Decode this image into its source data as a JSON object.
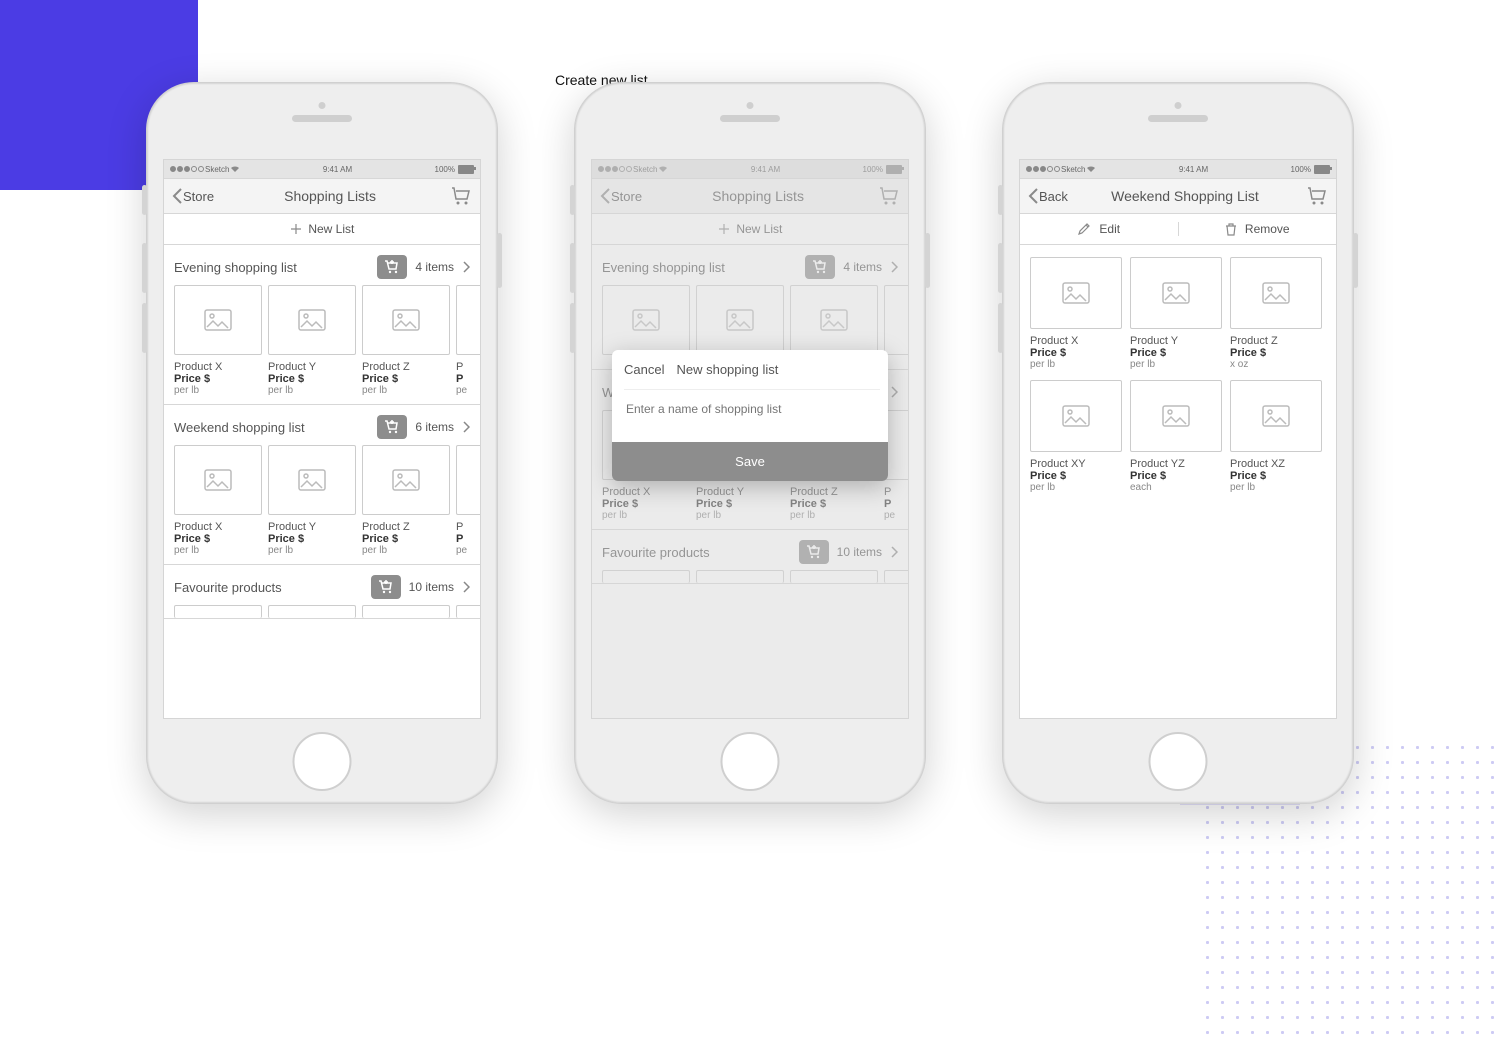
{
  "clip_label": "Create new list",
  "statusbar": {
    "carrier": "Sketch",
    "time": "9:41 AM",
    "battery": "100%"
  },
  "actionbar": {
    "new_list": "New List"
  },
  "screen1": {
    "back": "Store",
    "title": "Shopping Lists",
    "sections": [
      {
        "title": "Evening shopping list",
        "count": "4 items",
        "products": [
          {
            "name": "Product X",
            "price": "Price $",
            "unit": "per lb"
          },
          {
            "name": "Product Y",
            "price": "Price $",
            "unit": "per lb"
          },
          {
            "name": "Product Z",
            "price": "Price $",
            "unit": "per lb"
          },
          {
            "name": "P",
            "price": "P",
            "unit": "pe"
          }
        ]
      },
      {
        "title": "Weekend shopping list",
        "count": "6 items",
        "products": [
          {
            "name": "Product X",
            "price": "Price $",
            "unit": "per lb"
          },
          {
            "name": "Product Y",
            "price": "Price $",
            "unit": "per lb"
          },
          {
            "name": "Product Z",
            "price": "Price $",
            "unit": "per lb"
          },
          {
            "name": "P",
            "price": "P",
            "unit": "pe"
          }
        ]
      },
      {
        "title": "Favourite products",
        "count": "10 items",
        "products": []
      }
    ]
  },
  "screen2": {
    "back": "Store",
    "title": "Shopping Lists",
    "modal": {
      "cancel": "Cancel",
      "heading": "New shopping list",
      "placeholder": "Enter a name of shopping list",
      "save": "Save"
    },
    "sections": [
      {
        "title": "Evening shopping list",
        "count": "4 items",
        "products": [
          {
            "name": "",
            "price": "",
            "unit": ""
          },
          {
            "name": "",
            "price": "",
            "unit": ""
          },
          {
            "name": "",
            "price": "",
            "unit": ""
          },
          {
            "name": "",
            "price": "",
            "unit": ""
          }
        ]
      },
      {
        "title": "W",
        "count": "",
        "products": [
          {
            "name": "Product X",
            "price": "Price $",
            "unit": "per lb"
          },
          {
            "name": "Product Y",
            "price": "Price $",
            "unit": "per lb"
          },
          {
            "name": "Product Z",
            "price": "Price $",
            "unit": "per lb"
          },
          {
            "name": "P",
            "price": "P",
            "unit": "pe"
          }
        ]
      },
      {
        "title": "Favourite products",
        "count": "10 items",
        "products": []
      }
    ]
  },
  "screen3": {
    "back": "Back",
    "title": "Weekend Shopping List",
    "edit": "Edit",
    "remove": "Remove",
    "products": [
      {
        "name": "Product X",
        "price": "Price $",
        "unit": "per lb"
      },
      {
        "name": "Product Y",
        "price": "Price $",
        "unit": "per lb"
      },
      {
        "name": "Product Z",
        "price": "Price $",
        "unit": "x oz"
      },
      {
        "name": "Product XY",
        "price": "Price $",
        "unit": "per lb"
      },
      {
        "name": "Product YZ",
        "price": "Price $",
        "unit": "each"
      },
      {
        "name": "Product XZ",
        "price": "Price $",
        "unit": "per lb"
      }
    ]
  }
}
